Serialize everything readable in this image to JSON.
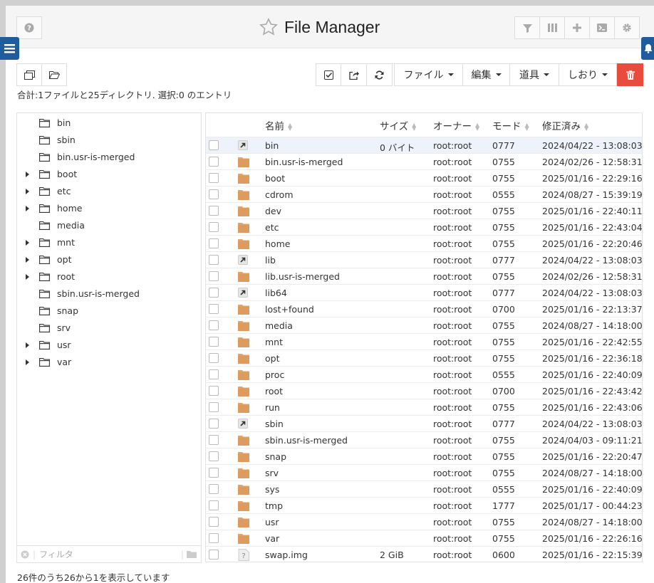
{
  "app": {
    "title": "File Manager"
  },
  "toolbar": {
    "file_menu": "ファイル",
    "edit_menu": "編集",
    "tools_menu": "道具",
    "bookmarks_menu": "しおり"
  },
  "summary": "合計:1ファイルと25ディレクトリ. 選択:0 のエントリ",
  "tree": {
    "items": [
      {
        "label": "bin",
        "expandable": false
      },
      {
        "label": "sbin",
        "expandable": false
      },
      {
        "label": "bin.usr-is-merged",
        "expandable": false
      },
      {
        "label": "boot",
        "expandable": true
      },
      {
        "label": "etc",
        "expandable": true
      },
      {
        "label": "home",
        "expandable": true
      },
      {
        "label": "media",
        "expandable": false
      },
      {
        "label": "mnt",
        "expandable": true
      },
      {
        "label": "opt",
        "expandable": true
      },
      {
        "label": "root",
        "expandable": true
      },
      {
        "label": "sbin.usr-is-merged",
        "expandable": false
      },
      {
        "label": "snap",
        "expandable": false
      },
      {
        "label": "srv",
        "expandable": false
      },
      {
        "label": "usr",
        "expandable": true
      },
      {
        "label": "var",
        "expandable": true
      }
    ],
    "filter_placeholder": "フィルタ"
  },
  "grid": {
    "headers": {
      "name": "名前",
      "size": "サイズ",
      "owner": "オーナー",
      "mode": "モード",
      "modified": "修正済み"
    },
    "rows": [
      {
        "icon": "symlink-icon",
        "name": "bin",
        "size": "0 バイト",
        "owner": "root:root",
        "mode": "0777",
        "modified": "2024/04/22 - 13:08:03"
      },
      {
        "icon": "folder-icon",
        "name": "bin.usr-is-merged",
        "size": "",
        "owner": "root:root",
        "mode": "0755",
        "modified": "2024/02/26 - 12:58:31"
      },
      {
        "icon": "folder-icon",
        "name": "boot",
        "size": "",
        "owner": "root:root",
        "mode": "0755",
        "modified": "2025/01/16 - 22:29:16"
      },
      {
        "icon": "folder-icon",
        "name": "cdrom",
        "size": "",
        "owner": "root:root",
        "mode": "0555",
        "modified": "2024/08/27 - 15:39:19"
      },
      {
        "icon": "folder-icon",
        "name": "dev",
        "size": "",
        "owner": "root:root",
        "mode": "0755",
        "modified": "2025/01/16 - 22:40:11"
      },
      {
        "icon": "folder-icon",
        "name": "etc",
        "size": "",
        "owner": "root:root",
        "mode": "0755",
        "modified": "2025/01/16 - 22:43:04"
      },
      {
        "icon": "folder-icon",
        "name": "home",
        "size": "",
        "owner": "root:root",
        "mode": "0755",
        "modified": "2025/01/16 - 22:20:46"
      },
      {
        "icon": "symlink-icon",
        "name": "lib",
        "size": "",
        "owner": "root:root",
        "mode": "0777",
        "modified": "2024/04/22 - 13:08:03"
      },
      {
        "icon": "folder-icon",
        "name": "lib.usr-is-merged",
        "size": "",
        "owner": "root:root",
        "mode": "0755",
        "modified": "2024/02/26 - 12:58:31"
      },
      {
        "icon": "symlink-icon",
        "name": "lib64",
        "size": "",
        "owner": "root:root",
        "mode": "0777",
        "modified": "2024/04/22 - 13:08:03"
      },
      {
        "icon": "folder-icon",
        "name": "lost+found",
        "size": "",
        "owner": "root:root",
        "mode": "0700",
        "modified": "2025/01/16 - 22:13:37"
      },
      {
        "icon": "folder-icon",
        "name": "media",
        "size": "",
        "owner": "root:root",
        "mode": "0755",
        "modified": "2024/08/27 - 14:18:00"
      },
      {
        "icon": "folder-icon",
        "name": "mnt",
        "size": "",
        "owner": "root:root",
        "mode": "0755",
        "modified": "2025/01/16 - 22:42:55"
      },
      {
        "icon": "folder-icon",
        "name": "opt",
        "size": "",
        "owner": "root:root",
        "mode": "0755",
        "modified": "2025/01/16 - 22:36:18"
      },
      {
        "icon": "folder-icon",
        "name": "proc",
        "size": "",
        "owner": "root:root",
        "mode": "0555",
        "modified": "2025/01/16 - 22:40:09"
      },
      {
        "icon": "folder-icon",
        "name": "root",
        "size": "",
        "owner": "root:root",
        "mode": "0700",
        "modified": "2025/01/16 - 22:43:42"
      },
      {
        "icon": "folder-icon",
        "name": "run",
        "size": "",
        "owner": "root:root",
        "mode": "0755",
        "modified": "2025/01/16 - 22:43:06"
      },
      {
        "icon": "symlink-icon",
        "name": "sbin",
        "size": "",
        "owner": "root:root",
        "mode": "0777",
        "modified": "2024/04/22 - 13:08:03"
      },
      {
        "icon": "folder-icon",
        "name": "sbin.usr-is-merged",
        "size": "",
        "owner": "root:root",
        "mode": "0755",
        "modified": "2024/04/03 - 09:11:21"
      },
      {
        "icon": "folder-icon",
        "name": "snap",
        "size": "",
        "owner": "root:root",
        "mode": "0755",
        "modified": "2025/01/16 - 22:20:47"
      },
      {
        "icon": "folder-icon",
        "name": "srv",
        "size": "",
        "owner": "root:root",
        "mode": "0755",
        "modified": "2024/08/27 - 14:18:00"
      },
      {
        "icon": "folder-icon",
        "name": "sys",
        "size": "",
        "owner": "root:root",
        "mode": "0555",
        "modified": "2025/01/16 - 22:40:09"
      },
      {
        "icon": "folder-icon",
        "name": "tmp",
        "size": "",
        "owner": "root:root",
        "mode": "1777",
        "modified": "2025/01/17 - 00:44:23"
      },
      {
        "icon": "folder-icon",
        "name": "usr",
        "size": "",
        "owner": "root:root",
        "mode": "0755",
        "modified": "2024/08/27 - 14:18:00"
      },
      {
        "icon": "folder-icon",
        "name": "var",
        "size": "",
        "owner": "root:root",
        "mode": "0755",
        "modified": "2025/01/16 - 22:26:16"
      },
      {
        "icon": "unknown-file-icon",
        "name": "swap.img",
        "size": "2 GiB",
        "owner": "root:root",
        "mode": "0600",
        "modified": "2025/01/16 - 22:15:39"
      }
    ]
  },
  "footer": "26件のうち26から1を表示しています",
  "colors": {
    "accent": "#1e5c9e",
    "danger": "#e74c3c",
    "folder": "#e3a468",
    "selected_row": "#eef3fb"
  }
}
